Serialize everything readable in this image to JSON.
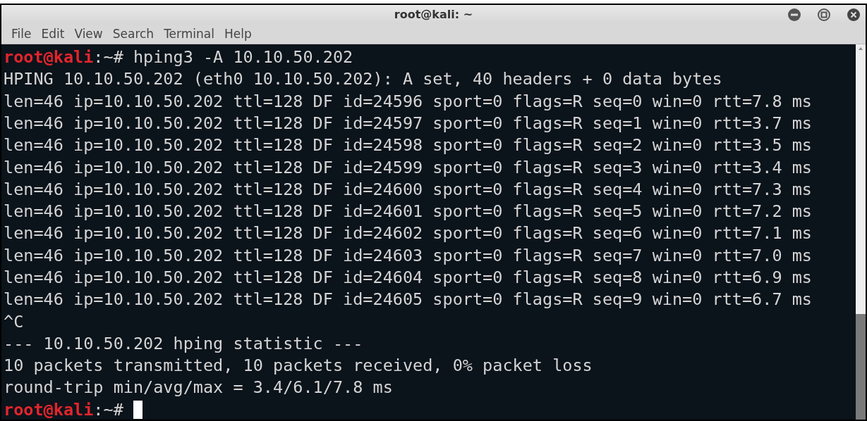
{
  "window": {
    "title": "root@kali: ~"
  },
  "menu": [
    "File",
    "Edit",
    "View",
    "Search",
    "Terminal",
    "Help"
  ],
  "lines": [
    {
      "kind": "prompt",
      "user": "root@kali",
      "rest": ":~# hping3 -A 10.10.50.202",
      "cursor": false
    },
    {
      "kind": "output",
      "text": "HPING 10.10.50.202 (eth0 10.10.50.202): A set, 40 headers + 0 data bytes"
    },
    {
      "kind": "output",
      "text": "len=46 ip=10.10.50.202 ttl=128 DF id=24596 sport=0 flags=R seq=0 win=0 rtt=7.8 ms"
    },
    {
      "kind": "output",
      "text": "len=46 ip=10.10.50.202 ttl=128 DF id=24597 sport=0 flags=R seq=1 win=0 rtt=3.7 ms"
    },
    {
      "kind": "output",
      "text": "len=46 ip=10.10.50.202 ttl=128 DF id=24598 sport=0 flags=R seq=2 win=0 rtt=3.5 ms"
    },
    {
      "kind": "output",
      "text": "len=46 ip=10.10.50.202 ttl=128 DF id=24599 sport=0 flags=R seq=3 win=0 rtt=3.4 ms"
    },
    {
      "kind": "output",
      "text": "len=46 ip=10.10.50.202 ttl=128 DF id=24600 sport=0 flags=R seq=4 win=0 rtt=7.3 ms"
    },
    {
      "kind": "output",
      "text": "len=46 ip=10.10.50.202 ttl=128 DF id=24601 sport=0 flags=R seq=5 win=0 rtt=7.2 ms"
    },
    {
      "kind": "output",
      "text": "len=46 ip=10.10.50.202 ttl=128 DF id=24602 sport=0 flags=R seq=6 win=0 rtt=7.1 ms"
    },
    {
      "kind": "output",
      "text": "len=46 ip=10.10.50.202 ttl=128 DF id=24603 sport=0 flags=R seq=7 win=0 rtt=7.0 ms"
    },
    {
      "kind": "output",
      "text": "len=46 ip=10.10.50.202 ttl=128 DF id=24604 sport=0 flags=R seq=8 win=0 rtt=6.9 ms"
    },
    {
      "kind": "output",
      "text": "len=46 ip=10.10.50.202 ttl=128 DF id=24605 sport=0 flags=R seq=9 win=0 rtt=6.7 ms"
    },
    {
      "kind": "output",
      "text": "^C"
    },
    {
      "kind": "output",
      "text": "--- 10.10.50.202 hping statistic ---"
    },
    {
      "kind": "output",
      "text": "10 packets transmitted, 10 packets received, 0% packet loss"
    },
    {
      "kind": "output",
      "text": "round-trip min/avg/max = 3.4/6.1/7.8 ms"
    },
    {
      "kind": "prompt",
      "user": "root@kali",
      "rest": ":~#",
      "cursor": true
    }
  ]
}
